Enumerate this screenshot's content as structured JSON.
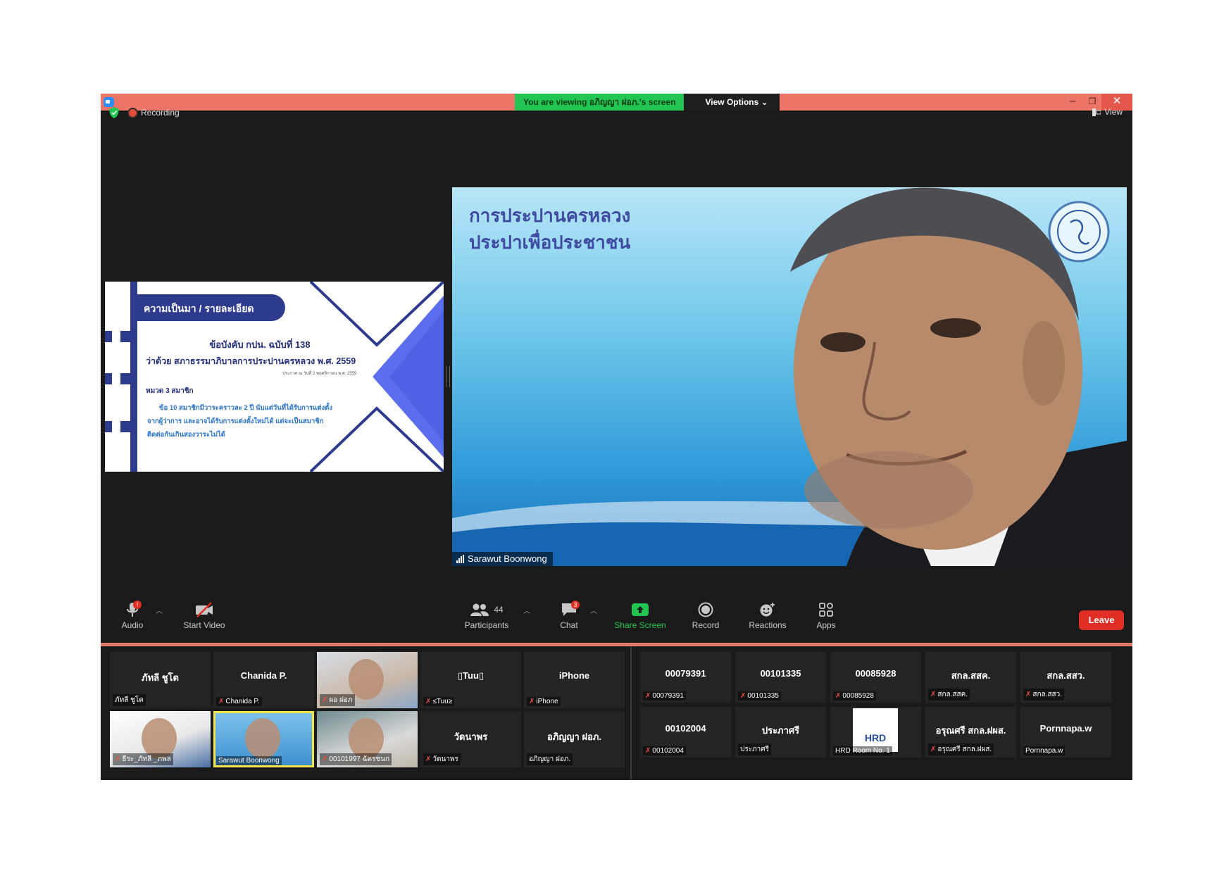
{
  "titlebar": {
    "banner_text": "You are viewing อภิญญา ฝอภ.'s screen",
    "view_options": "View Options",
    "minimize": "–",
    "restore": "❐",
    "close": "✕"
  },
  "status": {
    "recording": "Recording",
    "view": "View"
  },
  "shared_slide": {
    "heading": "ความเป็นมา / รายละเอียด",
    "line1": "ข้อบังคับ กปน. ฉบับที่ 138",
    "line2": "ว่าด้วย สภาธรรมาภิบาลการประปานครหลวง พ.ศ. 2559",
    "line3": "ประกาศ ณ วันที่ 2 พฤศจิกายน พ.ศ. 2559",
    "section": "หมวด 3 สมาชิก",
    "body1": "ข้อ 10 สมาชิกมีวาระคราวละ 2 ปี นับแต่วันที่ได้รับการแต่งตั้ง",
    "body2": "จากผู้ว่าการ และอาจได้รับการแต่งตั้งใหม่ได้ แต่จะเป็นสมาชิก",
    "body3": "ติดต่อกันเกินสองวาระไม่ได้"
  },
  "speaker": {
    "bg_line1": "การประปานครหลวง",
    "bg_line2": "ประปาเพื่อประชาชน",
    "name": "Sarawut Boonwong"
  },
  "toolbar": {
    "audio": "Audio",
    "audio_badge": "!",
    "start_video": "Start Video",
    "participants": "Participants",
    "participants_count": "44",
    "chat": "Chat",
    "chat_badge": "3",
    "share_screen": "Share Screen",
    "record": "Record",
    "reactions": "Reactions",
    "apps": "Apps",
    "leave": "Leave"
  },
  "gallery_left": [
    {
      "big": "ภัทลี ชูโต",
      "label": "ภัทลี ชูโต",
      "muted": false,
      "video": false
    },
    {
      "big": "Chanida P.",
      "label": "Chanida P.",
      "muted": true,
      "video": false
    },
    {
      "big": "",
      "label": "ผอ ฝอภ",
      "muted": true,
      "video": true
    },
    {
      "big": "▯Tuu▯",
      "label": "≤Tuu≥",
      "muted": true,
      "video": false
    },
    {
      "big": "iPhone",
      "label": "iPhone",
      "muted": true,
      "video": false
    },
    {
      "big": "",
      "label": "ธีระ_ภัทลี _ภพล",
      "muted": true,
      "video": true
    },
    {
      "big": "",
      "label": "Sarawut Boonwong",
      "muted": false,
      "video": true
    },
    {
      "big": "",
      "label": "00101997 ฉัตรชนก",
      "muted": true,
      "video": true
    },
    {
      "big": "วัดนาพร",
      "label": "วัดนาพร",
      "muted": true,
      "video": false
    },
    {
      "big": "อภิญญา ฝอภ.",
      "label": "อภิญญา ฝอภ.",
      "muted": false,
      "video": false
    }
  ],
  "gallery_right": [
    {
      "big": "00079391",
      "label": "00079391",
      "muted": true
    },
    {
      "big": "00101335",
      "label": "00101335",
      "muted": true
    },
    {
      "big": "00085928",
      "label": "00085928",
      "muted": true
    },
    {
      "big": "สกล.สสค.",
      "label": "สกล.สสค.",
      "muted": true
    },
    {
      "big": "สกล.สสว.",
      "label": "สกล.สสว.",
      "muted": true
    },
    {
      "big": "00102004",
      "label": "00102004",
      "muted": true
    },
    {
      "big": "ประภาศรี",
      "label": "ประภาศรี",
      "muted": false
    },
    {
      "big": "",
      "label": "HRD Room No. 1",
      "muted": false,
      "logo": "HRD"
    },
    {
      "big": "อรุณศรี สกล.ฝผส.",
      "label": "อรุณศรี สกล.ฝผส.",
      "muted": true
    },
    {
      "big": "Pornnapa.w",
      "label": "Pornnapa.w",
      "muted": false
    }
  ],
  "colors": {
    "titlebar": "#ec7567",
    "banner_green": "#23c552",
    "share_green": "#23c552",
    "leave_red": "#e02e24",
    "slide_navy": "#2e3a8c"
  }
}
